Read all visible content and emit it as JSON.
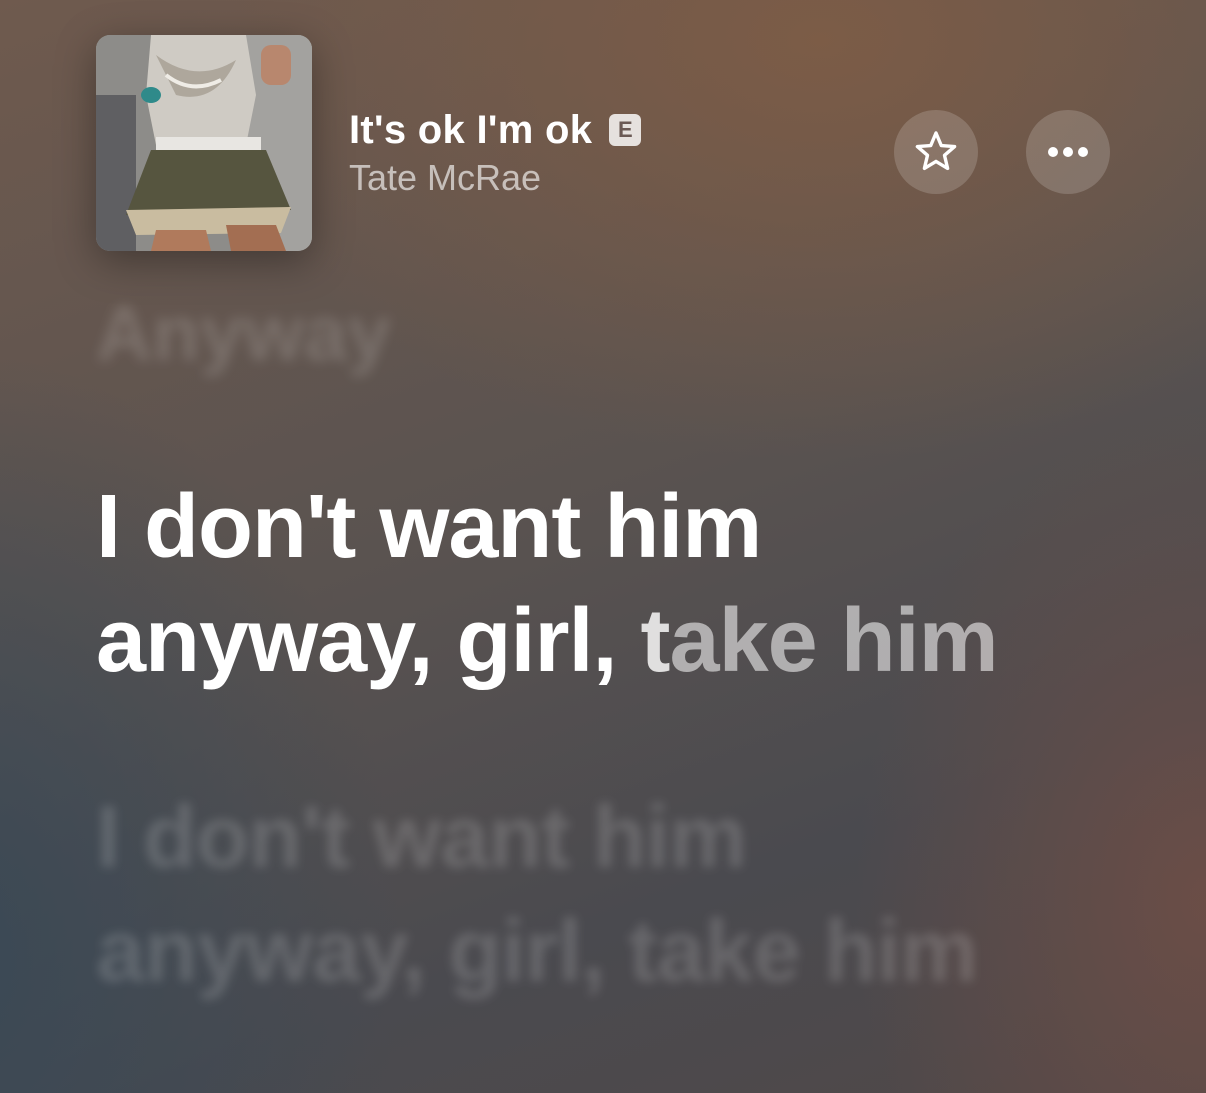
{
  "now_playing": {
    "title": "It's ok I'm ok",
    "explicit_badge": "E",
    "artist": "Tate McRae",
    "artwork_icon": "album-artwork"
  },
  "actions": {
    "favorite_icon": "star-icon",
    "more_icon": "ellipsis-icon"
  },
  "lyrics": {
    "previous_line": "Anyway",
    "current_line": {
      "line1": "I don't want him",
      "line2_sung": "anyway, girl, ",
      "line2_partial": "t",
      "line2_unsung": "ake him"
    },
    "next_line": {
      "line1": "I don't want him",
      "line2": "anyway, girl, take him"
    }
  },
  "colors": {
    "text_primary": "#ffffff",
    "background_warm": "#7d5c46",
    "background_cool": "#384856"
  }
}
